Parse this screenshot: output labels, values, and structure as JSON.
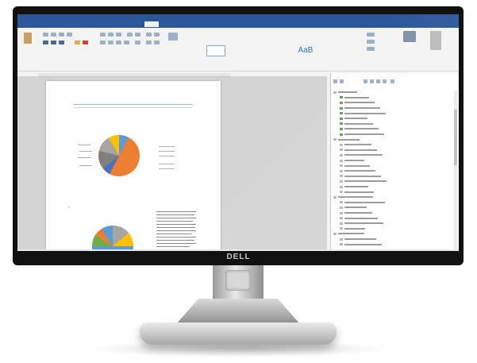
{
  "monitor": {
    "brand": "DELL"
  },
  "word_window": {
    "title": "",
    "tabs": [
      "",
      "",
      "",
      "",
      "",
      "",
      "",
      "",
      ""
    ],
    "tell_me": "",
    "styles": {
      "normal": "",
      "heading_sample": "AaB"
    },
    "group_labels": [
      "",
      "",
      "",
      "",
      ""
    ],
    "document": {
      "title": "",
      "chart_title": ""
    },
    "side_pane": {
      "header": "",
      "column_header": "",
      "tree_items": [
        "",
        "",
        "",
        "",
        "",
        "",
        "",
        "",
        "",
        "",
        "",
        "",
        "",
        "",
        "",
        "",
        "",
        "",
        "",
        "",
        "",
        "",
        "",
        "",
        "",
        "",
        "",
        "",
        "",
        ""
      ]
    }
  },
  "colors": {
    "ribbon_blue": "#2b579a",
    "pie_orange": "#ed7d31",
    "pie_blue": "#5b9bd5",
    "pie_gray": "#a5a5a5",
    "pie_yellow": "#ffc000",
    "pie_green": "#70ad47",
    "tree_green": "#5aa64a"
  }
}
